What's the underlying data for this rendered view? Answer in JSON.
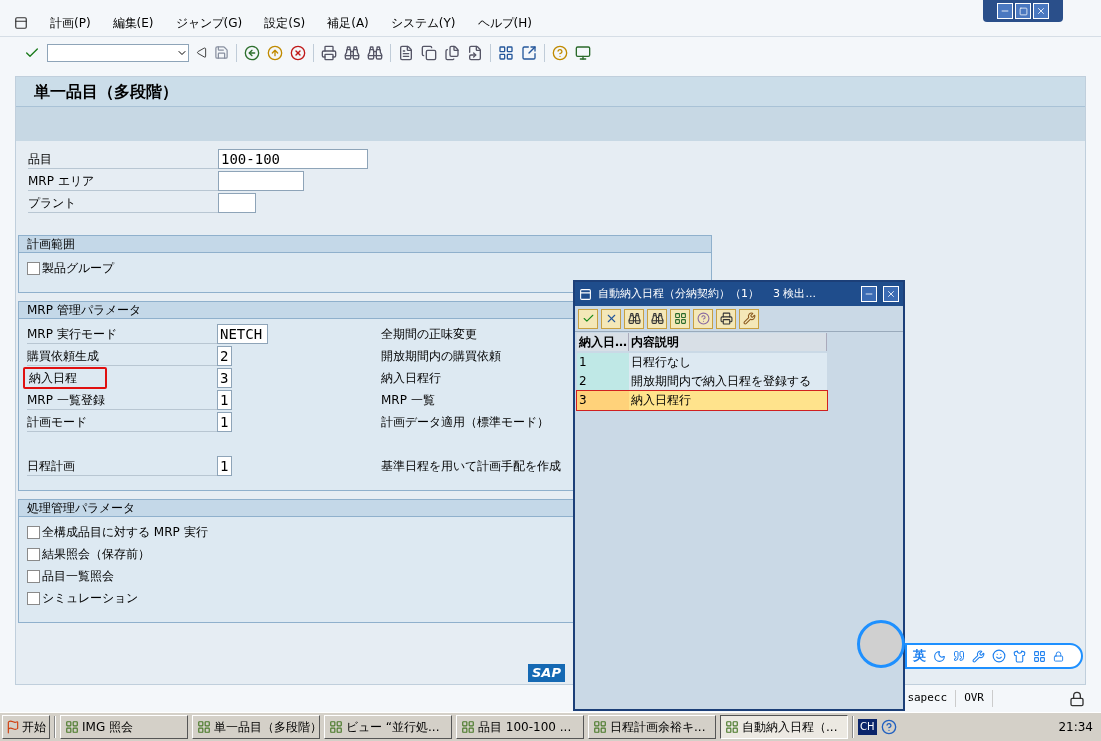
{
  "menu": [
    "計画(P)",
    "編集(E)",
    "ジャンプ(G)",
    "設定(S)",
    "補足(A)",
    "システム(Y)",
    "ヘルプ(H)"
  ],
  "screen_title": "単一品目（多段階）",
  "fields": [
    {
      "label": "品目",
      "value": "100-100"
    },
    {
      "label": "MRP エリア"
    },
    {
      "label": "プラント"
    }
  ],
  "planning_scope": {
    "title": "計画範囲",
    "options": [
      {
        "label": "製品グループ",
        "checked": false
      }
    ]
  },
  "mrp_parameters": {
    "title": "MRP 管理パラメータ",
    "rows": [
      {
        "label": "MRP 実行モード",
        "value": "NETCH",
        "description": "全期間の正味変更",
        "highlighted": false
      },
      {
        "label": "購買依頼生成",
        "value": "2",
        "description": "開放期間内の購買依頼",
        "highlighted": false
      },
      {
        "label": "納入日程",
        "value": "3",
        "description": "納入日程行",
        "highlighted": true
      },
      {
        "label": "MRP 一覧登録",
        "value": "1",
        "description": "MRP 一覧",
        "highlighted": false
      },
      {
        "label": "計画モード",
        "value": "1",
        "description": "計画データ適用（標準モード）",
        "highlighted": false
      },
      {
        "label": "日程計画",
        "value": "1",
        "description": "基準日程を用いて計画手配を作成",
        "highlighted": false
      }
    ]
  },
  "process_parameters": {
    "title": "処理管理パラメータ",
    "options": [
      {
        "label": "全構成品目に対する MRP 実行",
        "checked": false
      },
      {
        "label": "結果照会（保存前）",
        "checked": false
      },
      {
        "label": "品目一覧照会",
        "checked": false
      },
      {
        "label": "シミュレーション",
        "checked": false
      }
    ]
  },
  "logo": "SAP",
  "status_bar": [
    "sapecc",
    "OVR"
  ],
  "popup": {
    "title": "自動納入日程（分納契約）（1）",
    "hits": "3 検出...",
    "columns": [
      "納入日…",
      "内容説明"
    ],
    "rows": [
      {
        "code": "1",
        "text": "日程行なし",
        "selected": false
      },
      {
        "code": "2",
        "text": "開放期間内で納入日程を登録する",
        "selected": false
      },
      {
        "code": "3",
        "text": "納入日程行",
        "selected": true
      }
    ]
  },
  "ime_bar": {
    "mode": "英"
  },
  "taskbar": {
    "start": "开始",
    "items": [
      {
        "label": "IMG 照会",
        "selected": false
      },
      {
        "label": "単一品目（多段階）",
        "selected": false
      },
      {
        "label": "ビュー “並行処...",
        "selected": false
      },
      {
        "label": "品目 100-100 ...",
        "selected": false
      },
      {
        "label": "日程計画余裕キ...",
        "selected": false
      },
      {
        "label": "自動納入日程（...",
        "selected": true
      }
    ],
    "language": "CH",
    "clock": "21:34"
  }
}
